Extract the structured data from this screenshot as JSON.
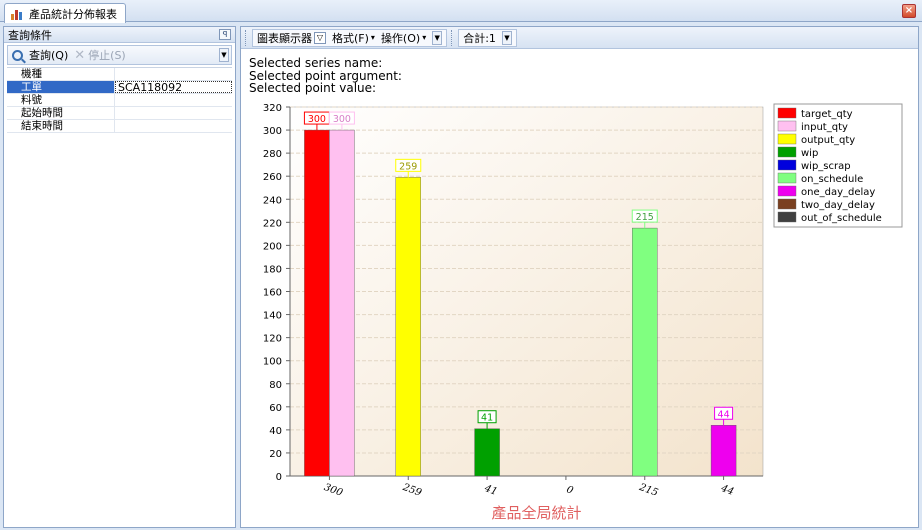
{
  "window": {
    "tab_title": "產品統計分佈報表",
    "close_label": "×"
  },
  "query_panel": {
    "title": "查詢條件",
    "pin_label": "ꟼ",
    "search_label": "查詢(Q)",
    "stop_label": "停止(S)",
    "fields": [
      {
        "label": "機種",
        "value": ""
      },
      {
        "label": "工單",
        "value": "SCA118092"
      },
      {
        "label": "料號",
        "value": ""
      },
      {
        "label": "起始時間",
        "value": ""
      },
      {
        "label": "結束時間",
        "value": ""
      }
    ]
  },
  "chart_toolbar": {
    "viewer_label": "圖表顯示器",
    "format_label": "格式(F)",
    "action_label": "操作(O)",
    "total_label": "合計:1"
  },
  "selection_info": {
    "series_name": "Selected series name:",
    "point_argument": "Selected point argument:",
    "point_value": "Selected point value:"
  },
  "colors": {
    "target_qty": "#ff0000",
    "input_qty": "#ffc0f0",
    "output_qty": "#ffff00",
    "wip": "#00a000",
    "wip_scrap": "#0000dd",
    "on_schedule": "#80ff80",
    "one_day_delay": "#ee00ee",
    "two_day_delay": "#7a4020",
    "out_of_schedule": "#404040"
  },
  "chart_data": {
    "type": "bar",
    "title": "產品全局統計",
    "ylim": [
      0,
      320
    ],
    "yticks": [
      0,
      20,
      40,
      60,
      80,
      100,
      120,
      140,
      160,
      180,
      200,
      220,
      240,
      260,
      280,
      300,
      320
    ],
    "categories": [
      "300",
      "259",
      "41",
      "0",
      "215",
      "44"
    ],
    "series": [
      {
        "name": "target_qty",
        "values": [
          300,
          null,
          null,
          null,
          null,
          null
        ]
      },
      {
        "name": "input_qty",
        "values": [
          300,
          null,
          null,
          null,
          null,
          null
        ]
      },
      {
        "name": "output_qty",
        "values": [
          null,
          259,
          null,
          null,
          null,
          null
        ]
      },
      {
        "name": "wip",
        "values": [
          null,
          null,
          41,
          null,
          null,
          null
        ]
      },
      {
        "name": "wip_scrap",
        "values": [
          null,
          null,
          null,
          0,
          null,
          null
        ]
      },
      {
        "name": "on_schedule",
        "values": [
          null,
          null,
          null,
          null,
          215,
          null
        ]
      },
      {
        "name": "one_day_delay",
        "values": [
          null,
          null,
          null,
          null,
          null,
          44
        ]
      },
      {
        "name": "two_day_delay",
        "values": [
          null,
          null,
          null,
          null,
          null,
          null
        ]
      },
      {
        "name": "out_of_schedule",
        "values": [
          null,
          null,
          null,
          null,
          null,
          null
        ]
      }
    ],
    "legend": [
      "target_qty",
      "input_qty",
      "output_qty",
      "wip",
      "wip_scrap",
      "on_schedule",
      "one_day_delay",
      "two_day_delay",
      "out_of_schedule"
    ],
    "legend_position": "top-right",
    "grid": true
  }
}
